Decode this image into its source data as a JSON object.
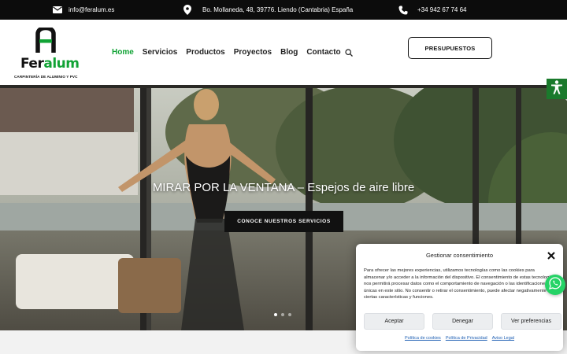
{
  "topbar": {
    "email": "info@feralum.es",
    "address": "Bo. Mollaneda, 48, 39776. Liendo (Cantabria) España",
    "phone": "+34 942 67 74 64"
  },
  "logo": {
    "word_fer": "Fer",
    "word_alum": "alum",
    "tagline": "CARPINTERÍA DE ALUMINIO Y PVC",
    "brand_green": "#11a335"
  },
  "nav": {
    "items": [
      {
        "label": "Home",
        "active": true
      },
      {
        "label": "Servicios"
      },
      {
        "label": "Productos"
      },
      {
        "label": "Proyectos"
      },
      {
        "label": "Blog"
      },
      {
        "label": "Contacto"
      }
    ]
  },
  "header": {
    "cta_label": "PRESUPUESTOS"
  },
  "hero": {
    "title": "MIRAR POR LA VENTANA – Espejos de aire libre",
    "button_label": "CONOCE NUESTROS SERVICIOS",
    "slide_count": 3,
    "active_slide": 1
  },
  "consent": {
    "title": "Gestionar consentimiento",
    "text": "Para ofrecer las mejores experiencias, utilizamos tecnologías como las cookies para almacenar y/o acceder a la información del dispositivo. El consentimiento de estas tecnologías nos permitirá procesar datos como el comportamiento de navegación o las identificaciones únicas en este sitio. No consentir o retirar el consentimiento, puede afectar negativamente a ciertas características y funciones.",
    "accept_label": "Aceptar",
    "deny_label": "Denegar",
    "prefs_label": "Ver preferencias",
    "links": [
      "Política de cookies",
      "Política de Privacidad",
      "Aviso Legal"
    ]
  },
  "icons": [
    "envelope-icon",
    "map-pin-icon",
    "phone-icon",
    "search-icon",
    "accessibility-icon",
    "whatsapp-icon",
    "close-icon"
  ]
}
